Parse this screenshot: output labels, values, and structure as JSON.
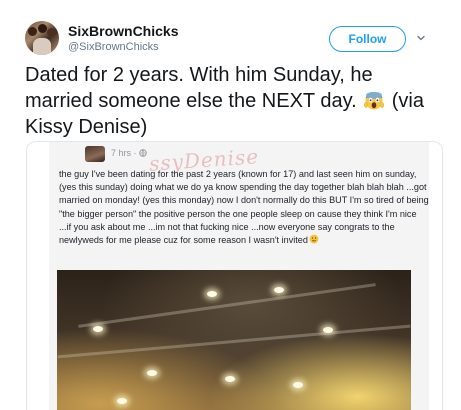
{
  "tweet": {
    "display_name": "SixBrownChicks",
    "handle": "@SixBrownChicks",
    "follow_label": "Follow",
    "text_main": "Dated for 2 years. With him Sunday, he married someone else the NEXT day.",
    "text_via": " (via Kissy Denise)",
    "emoji_icon": "screaming-face-icon"
  },
  "fb_post": {
    "timestamp": "7 hrs · ",
    "watermark": "ssyDenise",
    "body": "the guy I've been dating for the past 2 years (known for 17) and last seen him on sunday, (yes this sunday) doing what we do ya know spending the day together blah blah blah ...got married on monday! (yes this monday) now I don't normally do this BUT I'm so tired of being \"the bigger person\" the positive person the one people sleep on cause they think I'm nice ...if you ask about me ...im not that fucking nice ...now everyone say congrats to the newlyweds for me please cuz for some reason I wasn't invited"
  },
  "colors": {
    "accent": "#1da1f2",
    "text_primary": "#14171a",
    "text_secondary": "#657786"
  }
}
